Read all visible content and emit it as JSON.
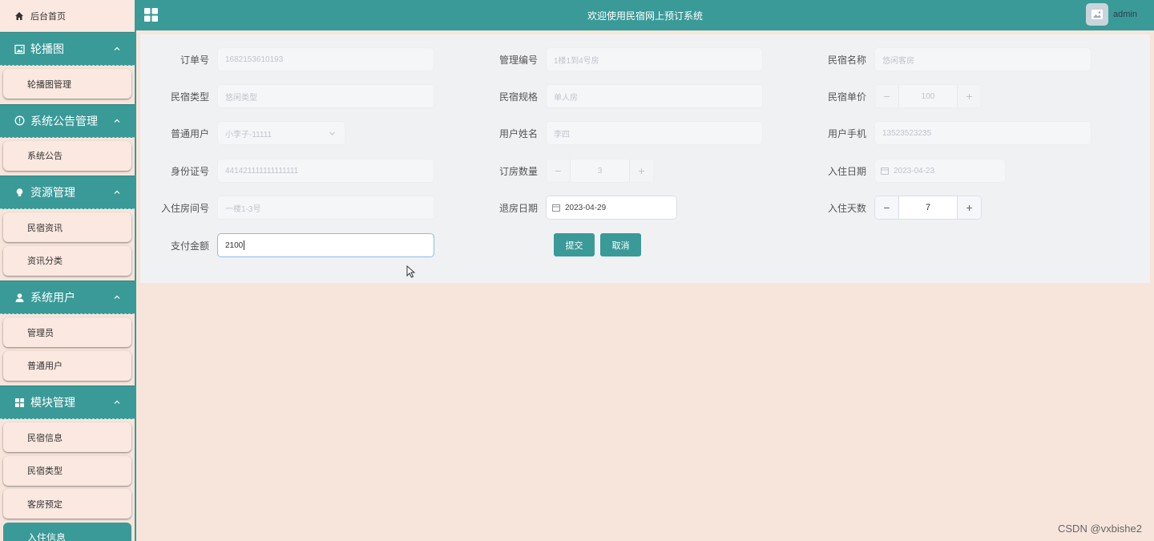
{
  "header": {
    "title": "欢迎使用民宿网上预订系统",
    "user": "admin"
  },
  "sidebar": {
    "home": "后台首页",
    "groups": [
      {
        "label": "轮播图",
        "items": [
          "轮播图管理"
        ]
      },
      {
        "label": "系统公告管理",
        "items": [
          "系统公告"
        ]
      },
      {
        "label": "资源管理",
        "items": [
          "民宿资讯",
          "资讯分类"
        ]
      },
      {
        "label": "系统用户",
        "items": [
          "管理员",
          "普通用户"
        ]
      },
      {
        "label": "模块管理",
        "items": [
          "民宿信息",
          "民宿类型",
          "客房预定",
          "入住信息"
        ]
      }
    ]
  },
  "form": {
    "order_no": {
      "label": "订单号",
      "value": "1682153610193"
    },
    "manage_no": {
      "label": "管理编号",
      "value": "1楼1到4号房"
    },
    "homestay_name": {
      "label": "民宿名称",
      "value": "悠闲客房"
    },
    "homestay_type": {
      "label": "民宿类型",
      "value": "悠闲类型"
    },
    "homestay_spec": {
      "label": "民宿规格",
      "value": "单人房"
    },
    "unit_price": {
      "label": "民宿单价",
      "value": "100"
    },
    "normal_user": {
      "label": "普通用户",
      "value": "小李子-11111"
    },
    "user_name": {
      "label": "用户姓名",
      "value": "李四"
    },
    "user_phone": {
      "label": "用户手机",
      "value": "13523523235"
    },
    "id_card": {
      "label": "身份证号",
      "value": "441421111111111111"
    },
    "room_count": {
      "label": "订房数量",
      "value": "3"
    },
    "checkin_date": {
      "label": "入住日期",
      "value": "2023-04-23"
    },
    "room_number": {
      "label": "入住房间号",
      "value": "一楼1-3号"
    },
    "checkout_date": {
      "label": "退房日期",
      "value": "2023-04-29"
    },
    "stay_days": {
      "label": "入住天数",
      "value": "7"
    },
    "payment": {
      "label": "支付金额",
      "value": "2100"
    }
  },
  "actions": {
    "submit": "提交",
    "cancel": "取消"
  },
  "steppers": {
    "minus": "−",
    "plus": "+"
  },
  "watermark": "CSDN @vxbishe2",
  "colors": {
    "primary": "#3a9a98",
    "background": "#f7e5dc",
    "panel": "#f0f1f3"
  }
}
